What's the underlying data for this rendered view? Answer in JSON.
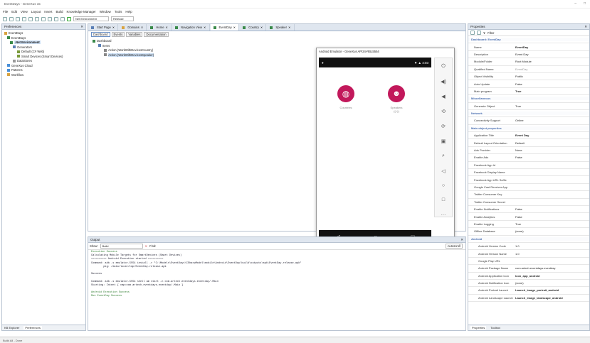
{
  "window": {
    "title": "EventDays - GeneXus 15",
    "controls": [
      "–",
      "□"
    ]
  },
  "menubar": [
    "File",
    "Edit",
    "View",
    "Layout",
    "Insert",
    "Build",
    "Knowledge Manager",
    "Window",
    "Tools",
    "Help"
  ],
  "toolbar": {
    "environment": "Net Environment",
    "config": "Release"
  },
  "preferences": {
    "title": "Preferences",
    "tree": [
      {
        "label": "EventDays",
        "indent": 0
      },
      {
        "label": "EventDays",
        "indent": 1
      },
      {
        "label": ".Net Environment",
        "indent": 2,
        "selected": true
      },
      {
        "label": "Generators",
        "indent": 3
      },
      {
        "label": "Default (C# Web)",
        "indent": 4
      },
      {
        "label": "Smart Devices (Smart Devices)",
        "indent": 4
      },
      {
        "label": "DataStores",
        "indent": 3
      },
      {
        "label": "GeneXus Cloud",
        "indent": 1
      },
      {
        "label": "Patterns",
        "indent": 1
      },
      {
        "label": "Workflow",
        "indent": 1
      }
    ],
    "bottom_tabs": [
      "KB Explorer",
      "Preferences"
    ]
  },
  "doc_tabs": [
    "Start Page",
    "Domains",
    "Home",
    "Navigation View",
    "EventDay",
    "Country",
    "Speaker"
  ],
  "sub_tabs": [
    "Dashboard",
    "Events",
    "Variables",
    "Documentation"
  ],
  "dashboard_tree": [
    {
      "label": "Dashboard",
      "indent": 0
    },
    {
      "label": "Items",
      "indent": 1
    },
    {
      "label": "Action (WorkWithDevicesCountry)",
      "indent": 2
    },
    {
      "label": "Action (WorkWithDevicesSpeaker)",
      "indent": 2
    }
  ],
  "emulator": {
    "title": "Android Emulator - GeneXus API24-RBL5554",
    "time": "4:03",
    "items": [
      {
        "label": "Countries",
        "icon": "globe-icon"
      },
      {
        "label": "Speakers",
        "icon": "speaker-icon"
      }
    ],
    "caption": "((+))"
  },
  "output": {
    "title": "Output",
    "show_label": "Show:",
    "show_value": "Build",
    "find_label": "Find:",
    "autoscroll": "Autoscroll",
    "lines": [
      {
        "t": "Execution Success",
        "c": "green"
      },
      {
        "t": "Calculating Mobile Targets for SmartDevices (Smart Devices)",
        "c": ""
      },
      {
        "t": "========== Android Execution started ==========",
        "c": ""
      },
      {
        "t": "Command: adb -s emulator-5554 install -r \"C:\\Models\\EventDays\\CSharpModel\\mobile\\Android\\EventDay\\build\\outputs\\apk\\EventDay-release.apk\"",
        "c": ""
      },
      {
        "t": "        pkg: /data/local/tmp/EventDay-release.apk",
        "c": ""
      },
      {
        "t": "",
        "c": ""
      },
      {
        "t": "Success",
        "c": ""
      },
      {
        "t": "",
        "c": ""
      },
      {
        "t": "Command: adb -s emulator-5554 shell am start -n com.artech.eventdays.eventday/.Main",
        "c": ""
      },
      {
        "t": "Starting: Intent { cmp=com.artech.eventdays.eventday/.Main }",
        "c": ""
      },
      {
        "t": "",
        "c": ""
      },
      {
        "t": "Android Execution Success",
        "c": "green"
      },
      {
        "t": "Run EventDay Success",
        "c": "green"
      }
    ]
  },
  "properties": {
    "title": "Properties",
    "filter": "Filter",
    "rows": [
      {
        "k": "Dashboard: EventDay",
        "v": "",
        "type": "cat"
      },
      {
        "k": "Name",
        "v": "EventDay",
        "bold": true
      },
      {
        "k": "Description",
        "v": "Event Day"
      },
      {
        "k": "Module/Folder",
        "v": "Root Module"
      },
      {
        "k": "Qualified Name",
        "v": "EventDay",
        "gray": true
      },
      {
        "k": "Object Visibility",
        "v": "Public"
      },
      {
        "k": "Auto Update",
        "v": "False"
      },
      {
        "k": "Main program",
        "v": "True",
        "bold": true
      },
      {
        "k": "Miscellaneous",
        "v": "",
        "type": "cat"
      },
      {
        "k": "Generate Object",
        "v": "True"
      },
      {
        "k": "Network",
        "v": "",
        "type": "cat"
      },
      {
        "k": "Connectivity Support",
        "v": "Online"
      },
      {
        "k": "Main object properties",
        "v": "",
        "type": "cat"
      },
      {
        "k": "Application Title",
        "v": "Event Day",
        "bold": true
      },
      {
        "k": "Default Layout Orientation",
        "v": "Default"
      },
      {
        "k": "Ads Provider",
        "v": "None"
      },
      {
        "k": "Enable Ads",
        "v": "False"
      },
      {
        "k": "Facebook App Id",
        "v": ""
      },
      {
        "k": "Facebook Display Name",
        "v": ""
      },
      {
        "k": "Facebook App URL Suffix",
        "v": ""
      },
      {
        "k": "Google Cast Receiver App",
        "v": ""
      },
      {
        "k": "Twitter Consumer Key",
        "v": ""
      },
      {
        "k": "Twitter Consumer Secret",
        "v": ""
      },
      {
        "k": "Enable Notifications",
        "v": "False"
      },
      {
        "k": "Enable Analytics",
        "v": "False"
      },
      {
        "k": "Enable Logging",
        "v": "True"
      },
      {
        "k": "Offline Database",
        "v": "(none)"
      },
      {
        "k": "Android",
        "v": "",
        "type": "cat"
      },
      {
        "k": "Android Version Code",
        "v": "1.0",
        "ind": true
      },
      {
        "k": "Android Version Name",
        "v": "1.0",
        "ind": true
      },
      {
        "k": "Google Play URL",
        "v": "",
        "ind": true
      },
      {
        "k": "Android Package Name",
        "v": "com.artech.eventdays.eventday",
        "ind": true
      },
      {
        "k": "Android Application Icon",
        "v": "Icon_app_android",
        "ind": true,
        "bold": true
      },
      {
        "k": "Android Notification Icon",
        "v": "(none)",
        "ind": true
      },
      {
        "k": "Android Portrait Launch",
        "v": "Launch_image_portrait_android",
        "ind": true,
        "bold": true
      },
      {
        "k": "Android Landscape Launch",
        "v": "Launch_image_landscape_android",
        "ind": true,
        "bold": true
      }
    ],
    "bottom_tabs": [
      "Properties",
      "Toolbox"
    ]
  },
  "status": {
    "left": "Build All - Done"
  },
  "colors": {
    "accent": "#c2185b",
    "chrome": "#dfe6ef"
  }
}
